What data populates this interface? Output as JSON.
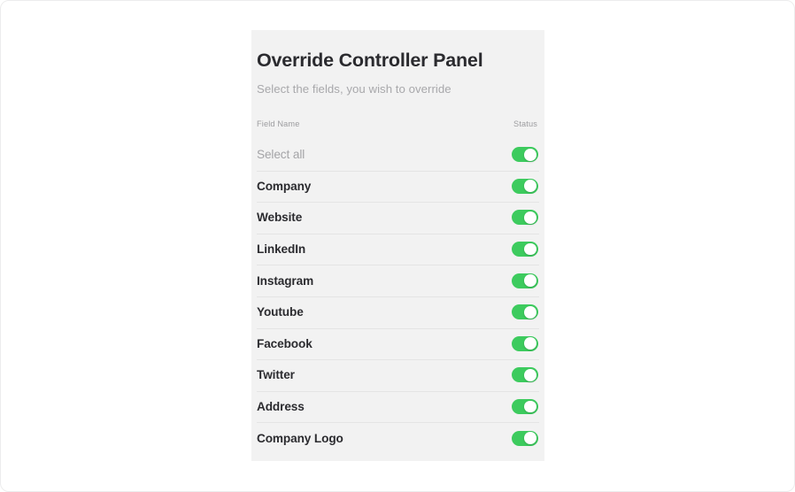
{
  "panel": {
    "title": "Override Controller Panel",
    "subtitle": "Select the fields, you wish to override",
    "columns": {
      "field_name": "Field Name",
      "status": "Status"
    },
    "accent_color": "#3dcb5e",
    "panel_background": "#f2f2f2",
    "page_background": "#ffffff",
    "rows": [
      {
        "label": "Select all",
        "status": "on",
        "muted": true
      },
      {
        "label": "Company",
        "status": "on",
        "muted": false
      },
      {
        "label": "Website",
        "status": "on",
        "muted": false
      },
      {
        "label": "LinkedIn",
        "status": "on",
        "muted": false
      },
      {
        "label": "Instagram",
        "status": "on",
        "muted": false
      },
      {
        "label": "Youtube",
        "status": "on",
        "muted": false
      },
      {
        "label": "Facebook",
        "status": "on",
        "muted": false
      },
      {
        "label": "Twitter",
        "status": "on",
        "muted": false
      },
      {
        "label": "Address",
        "status": "on",
        "muted": false
      },
      {
        "label": "Company Logo",
        "status": "on",
        "muted": false
      }
    ]
  }
}
